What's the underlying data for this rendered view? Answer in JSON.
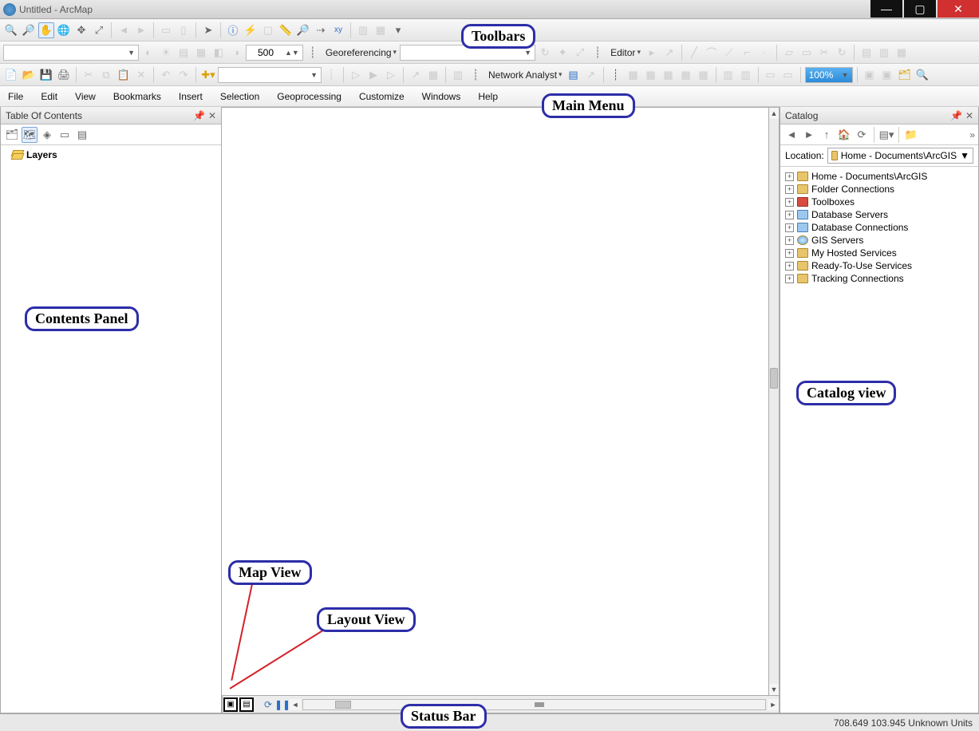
{
  "window": {
    "title": "Untitled - ArcMap",
    "min": "—",
    "max": "▢",
    "close": "✕"
  },
  "toolbar1": {
    "scale": "500"
  },
  "toolbar2": {
    "georef": "Georeferencing",
    "editor": "Editor"
  },
  "toolbar3": {
    "netanalyst": "Network Analyst",
    "zoom": "100%"
  },
  "menu": {
    "items": [
      "File",
      "Edit",
      "View",
      "Bookmarks",
      "Insert",
      "Selection",
      "Geoprocessing",
      "Customize",
      "Windows",
      "Help"
    ]
  },
  "toc": {
    "title": "Table Of Contents",
    "root": "Layers"
  },
  "catalog": {
    "title": "Catalog",
    "loc_label": "Location:",
    "loc_value": "Home - Documents\\ArcGIS",
    "items": [
      "Home - Documents\\ArcGIS",
      "Folder Connections",
      "Toolboxes",
      "Database Servers",
      "Database Connections",
      "GIS Servers",
      "My Hosted Services",
      "Ready-To-Use Services",
      "Tracking Connections"
    ]
  },
  "status": {
    "coords": "708.649 103.945 Unknown Units"
  },
  "annotations": {
    "toolbars": "Toolbars",
    "mainmenu": "Main Menu",
    "contents": "Contents Panel",
    "mapview": "Map View",
    "layoutview": "Layout View",
    "catalogview": "Catalog view",
    "statusbar": "Status Bar"
  }
}
